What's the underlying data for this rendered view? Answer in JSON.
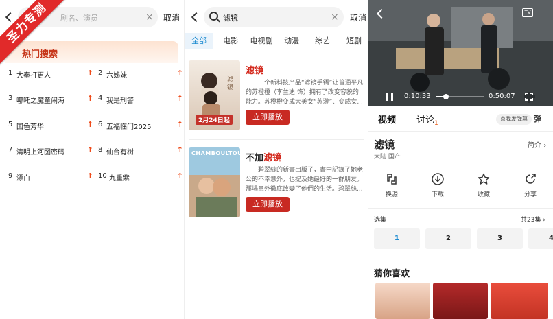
{
  "watermark": "圣力专测",
  "search_history_panel": {
    "search_placeholder": "剧名、演员",
    "cancel_label": "取消",
    "hot_search_title": "热门搜索",
    "hot_items": [
      {
        "rank": "1",
        "title": "大奉打更人"
      },
      {
        "rank": "2",
        "title": "六姊妹"
      },
      {
        "rank": "3",
        "title": "哪吒之魔童闹海"
      },
      {
        "rank": "4",
        "title": "我是刑警"
      },
      {
        "rank": "5",
        "title": "国色芳华"
      },
      {
        "rank": "6",
        "title": "五福临门2025"
      },
      {
        "rank": "7",
        "title": "清明上河图密码"
      },
      {
        "rank": "8",
        "title": "仙台有树"
      },
      {
        "rank": "9",
        "title": "漂白"
      },
      {
        "rank": "10",
        "title": "九重紫"
      }
    ],
    "trend_icon": "↑"
  },
  "search_results_panel": {
    "query": "滤镜",
    "cancel_label": "取消",
    "tabs": [
      "全部",
      "电影",
      "电视剧",
      "动漫",
      "综艺",
      "短剧"
    ],
    "active_tab": "全部",
    "results": [
      {
        "title_highlight": "滤镜",
        "title_prefix": "",
        "description": "一个新科技产品“滤镜手镯”让普通平凡的苏橙橙（李兰迪 饰）拥有了改变容貌的能力。苏橙橙变成大美女“苏渺”、变成女...",
        "poster_text": "2月24日起",
        "play_label": "立即播放"
      },
      {
        "title_prefix": "不加",
        "title_highlight": "滤镜",
        "description": "碧翠絲的新書出版了，書中記錄了她老公的不幸意外，也提及她最好的一群朋友。那場意外徹底改變了他們的生活。碧翠絲...",
        "poster_text": "CHAMBOULTOUT",
        "play_label": "立即播放"
      }
    ]
  },
  "player_panel": {
    "time_current": "0:10:33",
    "time_total": "0:50:07",
    "progress_fraction": 0.21,
    "tv_icon_label": "TV",
    "tab_video": "视频",
    "tab_discuss": "讨论",
    "discuss_count": "1",
    "danmu_prompt": "点我发弹幕",
    "danmu_icon": "弹",
    "title": "滤镜",
    "meta": "大陆 国产",
    "intro_label": "简介",
    "actions": [
      {
        "icon": "switch-source-icon",
        "label": "换源"
      },
      {
        "icon": "download-icon",
        "label": "下载"
      },
      {
        "icon": "star-icon",
        "label": "收藏"
      },
      {
        "icon": "share-icon",
        "label": "分享"
      }
    ],
    "episodes_label": "选集",
    "episodes_total": "共23集",
    "episodes": [
      "1",
      "2",
      "3",
      "4"
    ],
    "active_episode": "1",
    "guess_title": "猜你喜欢"
  }
}
